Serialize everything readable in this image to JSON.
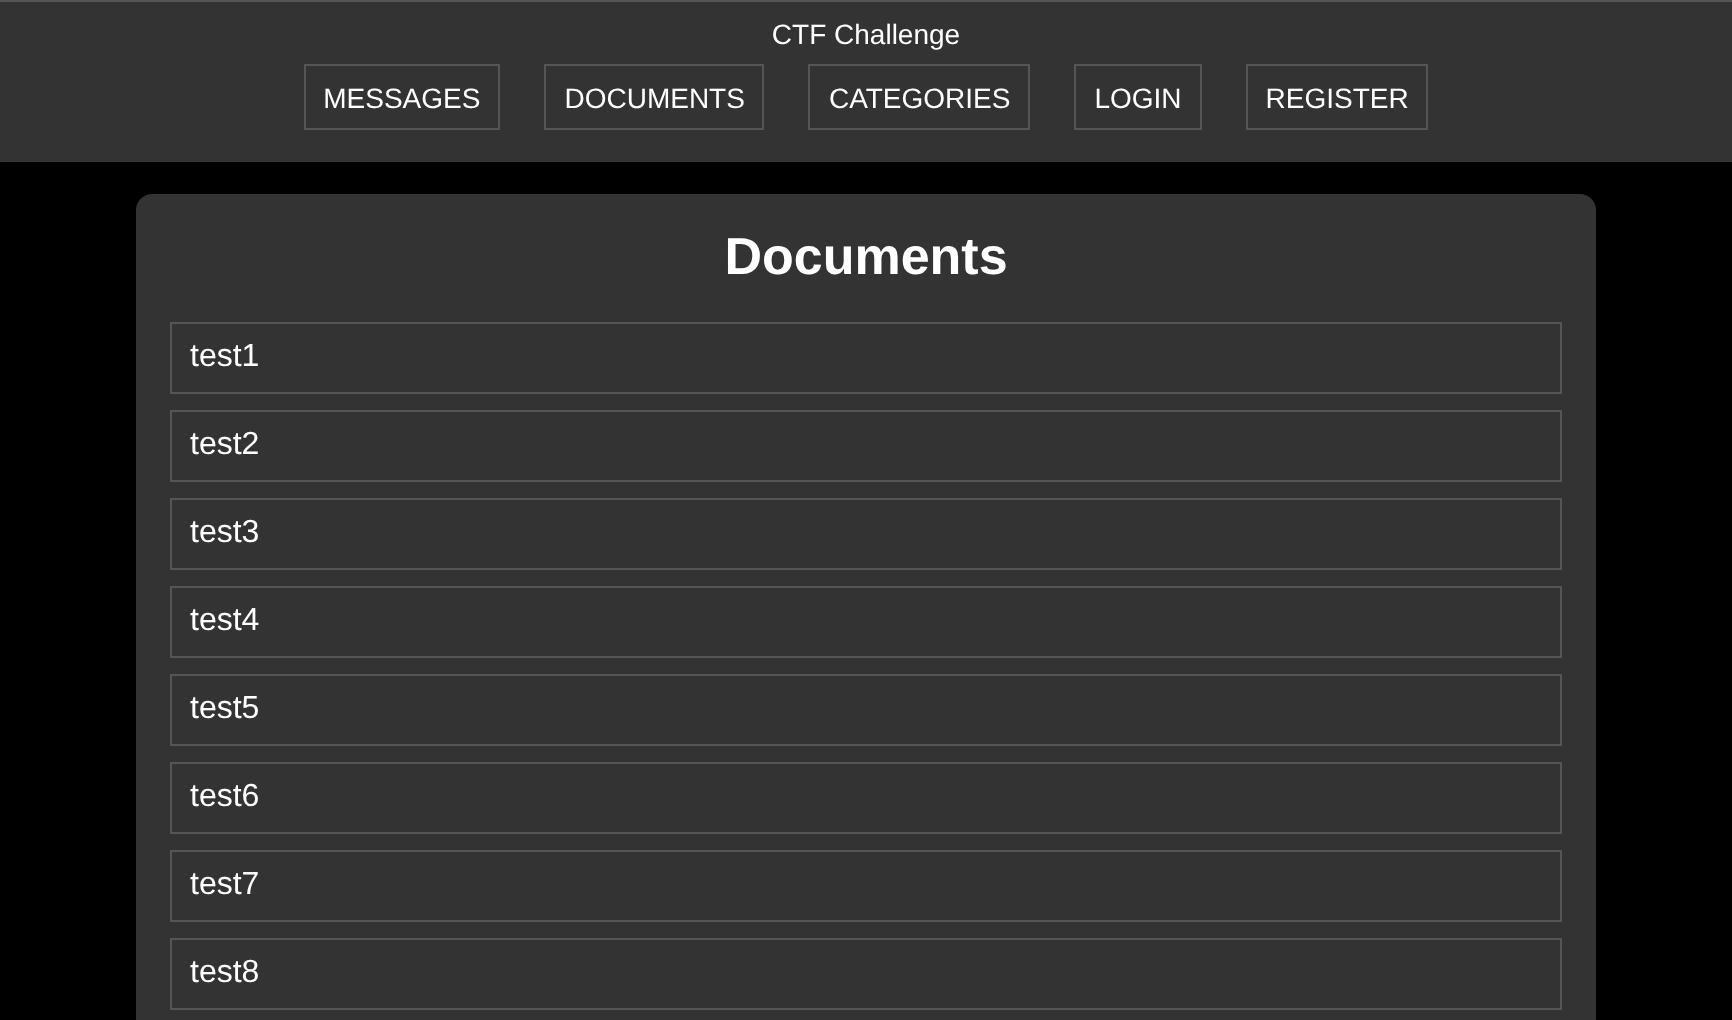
{
  "header": {
    "title": "CTF Challenge",
    "nav": [
      {
        "label": "MESSAGES"
      },
      {
        "label": "DOCUMENTS"
      },
      {
        "label": "CATEGORIES"
      },
      {
        "label": "LOGIN"
      },
      {
        "label": "REGISTER"
      }
    ]
  },
  "main": {
    "heading": "Documents",
    "documents": [
      {
        "title": "test1"
      },
      {
        "title": "test2"
      },
      {
        "title": "test3"
      },
      {
        "title": "test4"
      },
      {
        "title": "test5"
      },
      {
        "title": "test6"
      },
      {
        "title": "test7"
      },
      {
        "title": "test8"
      }
    ]
  }
}
